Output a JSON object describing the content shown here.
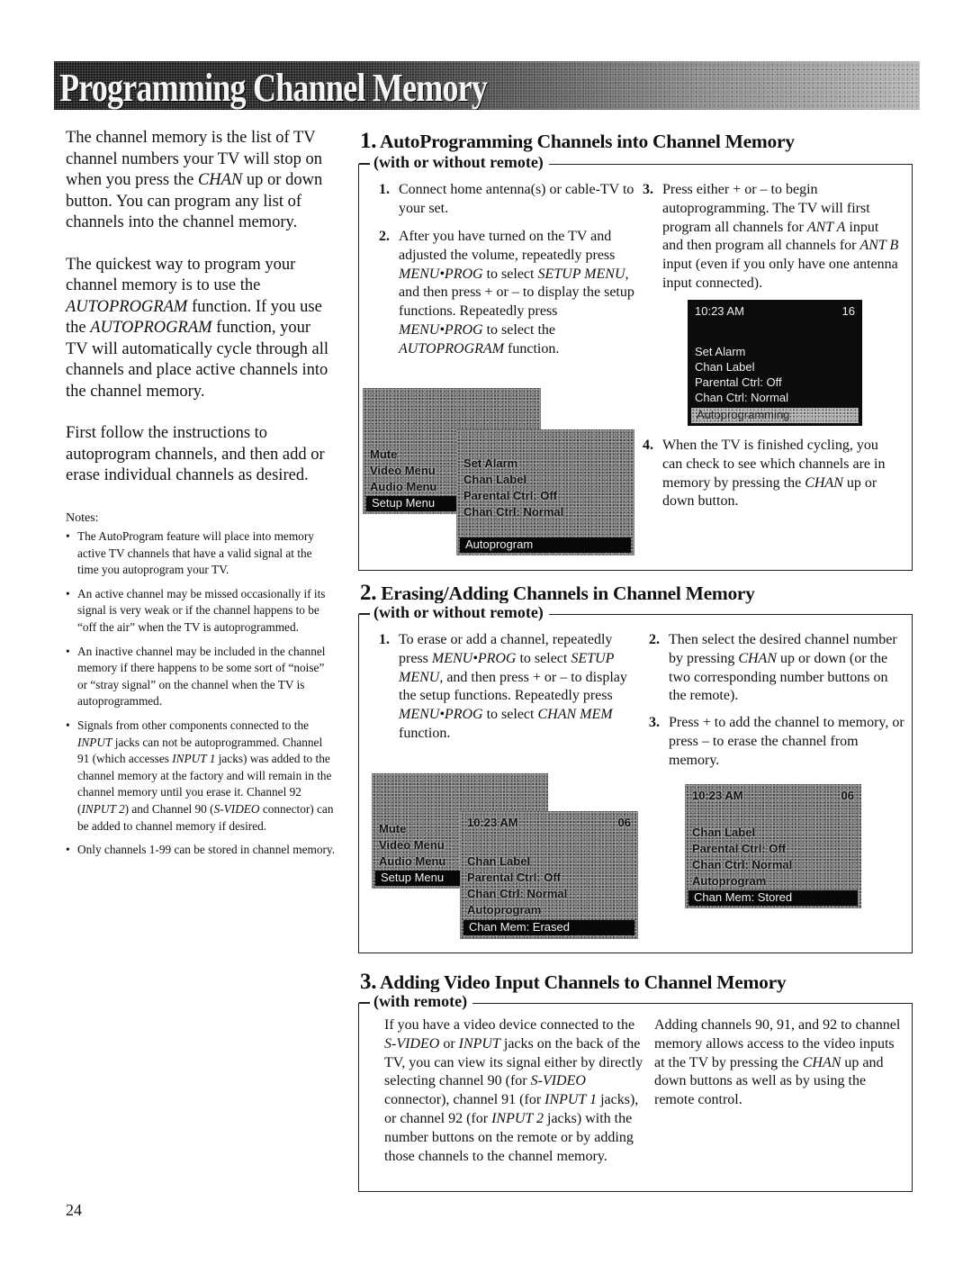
{
  "banner": {
    "title": "Programming Channel Memory"
  },
  "intro": {
    "p1": "The channel memory is the list of TV channel numbers your TV will stop on when you press the CHAN up or down button. You can program any list of channels into the channel memory.",
    "p2_a": "The quickest way to program your channel memory is to use the ",
    "p2_b": "AUTOPROGRAM",
    "p2_c": " function. If you use the ",
    "p2_d": "AUTOPROGRAM",
    "p2_e": " function, your TV will automatically cycle through all channels and place active channels into the channel memory.",
    "p3": "First follow the instructions to autoprogram channels, and then add or erase individual channels as desired.",
    "p1_a": "The channel memory is the list of TV channel numbers your TV will stop on when you press the ",
    "p1_b": "CHAN",
    "p1_c": " up or down button. You can program any list of channels into the channel memory."
  },
  "notes": {
    "title": "Notes:",
    "items": [
      "The AutoProgram feature will place into memory active TV channels that have a valid signal at the time you autoprogram your TV.",
      "An active channel may be missed occasionally if its signal is very weak or if the channel happens to be “off the air” when the TV is autoprogrammed.",
      "An inactive channel may be included in the channel memory if there happens to be some sort of “noise” or “stray signal” on the channel when the TV is autoprogrammed."
    ],
    "item4": {
      "a": "Signals from other components connected to the ",
      "b": "INPUT",
      "c": " jacks can not be autoprogrammed. Channel 91 (which accesses ",
      "d": "INPUT 1",
      "e": " jacks) was added to the channel memory at the factory and will remain in the channel memory until you erase it. Channel 92 (",
      "f": "INPUT 2",
      "g": ") and Channel 90 (",
      "h": "S-VIDEO",
      "i": " connector) can be added to channel memory if desired."
    },
    "item5": "Only channels 1-99 can be stored in channel memory."
  },
  "section1": {
    "num": "1.",
    "title": " AutoProgramming Channels into Channel Memory",
    "label": "(with or without remote)",
    "step1": {
      "n": "1.",
      "text": "Connect home antenna(s) or cable-TV to your set."
    },
    "step2": {
      "n": "2.",
      "a": "After you have turned on the TV and adjusted the volume, repeatedly press ",
      "b": "MENU•PROG",
      "c": " to select ",
      "d": "SETUP MENU",
      "e": ", and then press + or – to display the setup functions. Repeatedly press ",
      "f": "MENU•PROG",
      "g": " to select the ",
      "h": "AUTOPROGRAM",
      "i": " function."
    },
    "step3": {
      "n": "3.",
      "a": "Press either + or – to begin autoprogramming. The TV will first program all channels for ",
      "b": "ANT A",
      "c": " input and then program all channels for ",
      "d": "ANT B",
      "e": " input (even if you only have one antenna input connected)."
    },
    "step4": {
      "n": "4.",
      "a": "When the TV is finished cycling, you can check to see which channels are in memory by pressing the ",
      "b": "CHAN",
      "c": " up or down button."
    },
    "screen_main_menu": [
      "Mute",
      "Video Menu",
      "Audio Menu"
    ],
    "screen_main_selected": "Setup Menu",
    "screen_setup_menu": [
      "Set Alarm",
      "Chan Label",
      "Parental Ctrl: Off",
      "Chan Ctrl: Normal"
    ],
    "screen_setup_selected": "Autoprogram",
    "screen_progress": {
      "clock": "10:23 AM",
      "channel": "16",
      "items": [
        "Set Alarm",
        "Chan Label",
        "Parental Ctrl:  Off",
        "Chan Ctrl:  Normal"
      ],
      "selected": "Autoprogramming"
    }
  },
  "section2": {
    "num": "2.",
    "title": " Erasing/Adding Channels in Channel Memory",
    "label": "(with or without remote)",
    "step1": {
      "n": "1.",
      "a": "To erase or add a channel, repeatedly press ",
      "b": "MENU•PROG",
      "c": " to select ",
      "d": "SETUP MENU",
      "e": ", and then press + or – to display the setup functions. Repeatedly press ",
      "f": "MENU•PROG",
      "g": " to select ",
      "h": "CHAN MEM",
      "i": " function."
    },
    "step2": {
      "n": "2.",
      "a": "Then select the desired channel number by pressing ",
      "b": "CHAN",
      "c": " up or down (or the two corresponding number buttons on the remote)."
    },
    "step3": {
      "n": "3.",
      "text": "Press + to add the channel to memory, or press – to erase the channel from memory."
    },
    "screen_main_menu": [
      "Mute",
      "Video Menu",
      "Audio Menu"
    ],
    "screen_main_selected": "Setup Menu",
    "screen_erased": {
      "clock": "10:23 AM",
      "channel": "06",
      "items": [
        "Chan Label",
        "Parental Ctrl: Off",
        "Chan Ctrl: Normal",
        "Autoprogram"
      ],
      "selected": "Chan Mem:  Erased"
    },
    "screen_stored": {
      "clock": "10:23 AM",
      "channel": "06",
      "items": [
        "Chan Label",
        "Parental Ctrl: Off",
        "Chan Ctrl: Normal",
        "Autoprogram"
      ],
      "selected": "Chan Mem:  Stored"
    }
  },
  "section3": {
    "num": "3.",
    "title": " Adding Video Input Channels to Channel Memory",
    "label": "(with remote)",
    "col1": {
      "a": "If you have a video device connected to the ",
      "b": "S-VIDEO",
      "c": " or ",
      "d": "INPUT",
      "e": " jacks on the back of the TV, you can view its signal either by directly selecting channel 90 (for ",
      "f": "S-VIDEO",
      "g": " connector), channel 91 (for ",
      "h": "INPUT 1",
      "i": " jacks), or channel 92 (for ",
      "j": "INPUT 2",
      "k": " jacks) with the number buttons on the remote or by adding those channels to the channel memory."
    },
    "col2": {
      "a": "Adding channels 90, 91, and 92 to channel memory allows access to the video inputs at the TV by pressing the ",
      "b": "CHAN",
      "c": " up and down buttons as well as by using the remote control."
    }
  },
  "page_number": "24"
}
